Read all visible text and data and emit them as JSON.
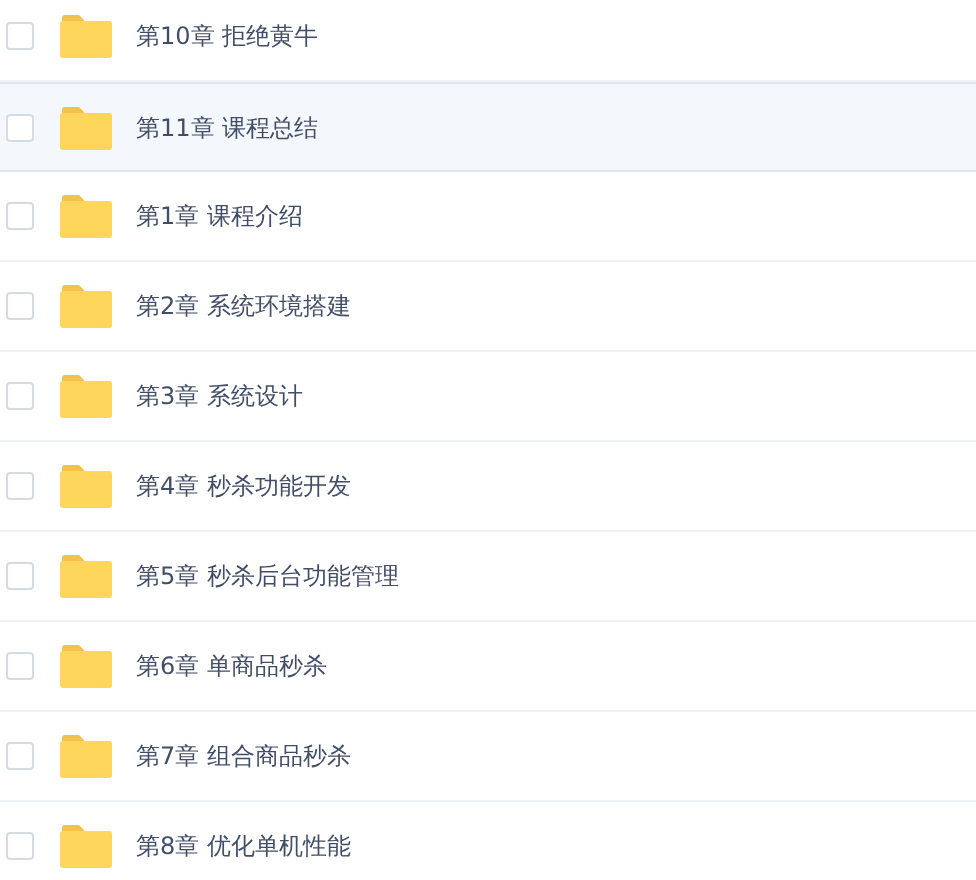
{
  "folders": [
    {
      "name": "第10章 拒绝黄牛",
      "selected": false,
      "checked": false
    },
    {
      "name": "第11章 课程总结",
      "selected": true,
      "checked": false
    },
    {
      "name": "第1章 课程介绍",
      "selected": false,
      "checked": false
    },
    {
      "name": "第2章 系统环境搭建",
      "selected": false,
      "checked": false
    },
    {
      "name": "第3章 系统设计",
      "selected": false,
      "checked": false
    },
    {
      "name": "第4章 秒杀功能开发",
      "selected": false,
      "checked": false
    },
    {
      "name": "第5章 秒杀后台功能管理",
      "selected": false,
      "checked": false
    },
    {
      "name": "第6章 单商品秒杀",
      "selected": false,
      "checked": false
    },
    {
      "name": "第7章 组合商品秒杀",
      "selected": false,
      "checked": false
    },
    {
      "name": "第8章 优化单机性能",
      "selected": false,
      "checked": false
    }
  ]
}
